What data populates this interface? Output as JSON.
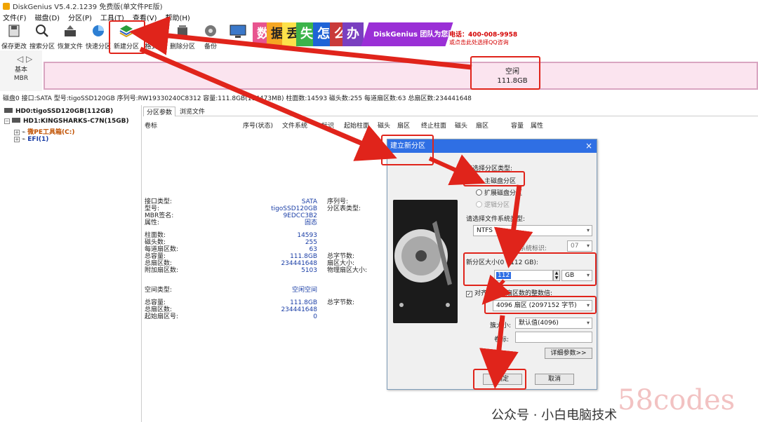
{
  "window": {
    "title": "DiskGenius V5.4.2.1239 免费版(单文件PE版)"
  },
  "menu": [
    "文件(F)",
    "磁盘(D)",
    "分区(P)",
    "工具(T)",
    "查看(V)",
    "帮助(H)"
  ],
  "toolbar": [
    {
      "label": "保存更改",
      "icon": "save-icon"
    },
    {
      "label": "搜索分区",
      "icon": "search-icon"
    },
    {
      "label": "恢复文件",
      "icon": "recover-icon"
    },
    {
      "label": "快速分区",
      "icon": "quick-partition-icon"
    },
    {
      "label": "新建分区",
      "icon": "new-partition-icon"
    },
    {
      "label": "格式化",
      "icon": "format-icon"
    },
    {
      "label": "删除分区",
      "icon": "delete-icon"
    },
    {
      "label": "备份",
      "icon": "backup-icon"
    }
  ],
  "banner": {
    "tiles": [
      "数",
      "据",
      "丢",
      "失",
      "怎",
      "么",
      "办"
    ],
    "slogan": "DiskGenius 团队为您服务",
    "phone": "电话：400-008-9958",
    "qq": "或点击此处选择QQ咨询"
  },
  "diskmap": {
    "type_line1": "基本",
    "type_line2": "MBR",
    "free_label": "空闲",
    "free_size": "111.8GB"
  },
  "diskinfo": "磁盘0 接口:SATA  型号:tigoSSD120GB  序列号:RW19330240C8312  容量:111.8GB(114473MB)  柱面数:14593  磁头数:255  每道扇区数:63  总扇区数:234441648",
  "tree": {
    "hd0": "HD0:tigoSSD120GB(112GB)",
    "hd1": "HD1:KINGSHARKS-C7N(15GB)",
    "pe": "微PE工具箱(C:)",
    "efi": "EFI(1)"
  },
  "tabs": [
    "分区参数",
    "浏览文件"
  ],
  "columns": [
    "卷标",
    "序号(状态)",
    "文件系统",
    "标识",
    "起始柱面",
    "磁头",
    "扇区",
    "终止柱面",
    "磁头",
    "扇区",
    "容量",
    "属性"
  ],
  "info": {
    "left": [
      {
        "k": "接口类型:",
        "v": "SATA"
      },
      {
        "k": "型号:",
        "v": "tigoSSD120GB"
      },
      {
        "k": "MBR签名:",
        "v": "9EDCC3B2"
      },
      {
        "k": "属性:",
        "v": "固态"
      }
    ],
    "left2": [
      {
        "k": "柱面数:",
        "v": "14593"
      },
      {
        "k": "磁头数:",
        "v": "255"
      },
      {
        "k": "每道扇区数:",
        "v": "63"
      },
      {
        "k": "总容量:",
        "v": "111.8GB"
      },
      {
        "k": "总扇区数:",
        "v": "234441648"
      },
      {
        "k": "附加扇区数:",
        "v": "5103"
      }
    ],
    "right": [
      "序列号:",
      "分区表类型:"
    ],
    "right2": [
      "总字节数:",
      "扇区大小:",
      "物理扇区大小:"
    ],
    "space_type_k": "空间类型:",
    "space_type_v": "空闲空间",
    "total_k": "总容量:",
    "total_v": "111.8GB",
    "sectors_k": "总扇区数:",
    "sectors_v": "234441648",
    "start_k": "起始扇区号:",
    "start_v": "0",
    "bytes_k": "总字节数:"
  },
  "dialog": {
    "title": "建立新分区",
    "close": "×",
    "type_prompt": "请选择分区类型:",
    "opt_primary": "主磁盘分区",
    "opt_extended": "扩展磁盘分区",
    "opt_logical": "逻辑分区",
    "fs_prompt": "请选择文件系统类型:",
    "fs_value": "NTFS",
    "sysid_label": "系统标识:",
    "sysid_value": "07",
    "size_label": "新分区大小(0 - 112 GB):",
    "size_value": "112",
    "size_unit": "GB",
    "align_label": "对齐到下列扇区数的整数倍:",
    "align_value": "4096 扇区 (2097152 字节)",
    "cluster_label": "簇大小:",
    "cluster_value": "默认值(4096)",
    "volume_label": "卷标:",
    "advanced": "详细参数>>",
    "ok": "确定",
    "cancel": "取消"
  },
  "watermark": "58codes",
  "wechat": "公众号 · 小白电脑技术",
  "colors": {
    "accent_red": "#e0241b",
    "dialog_blue": "#2f6fe4",
    "disk_pink": "#fbe4ef"
  }
}
